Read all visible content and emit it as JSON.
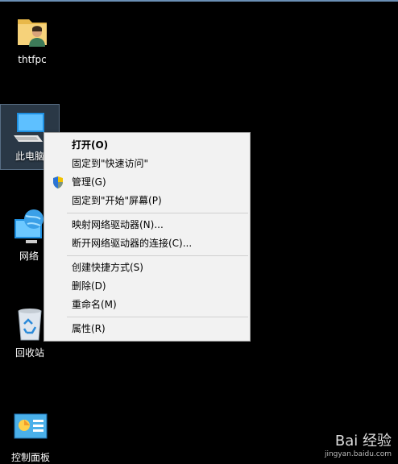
{
  "desktop": {
    "icons": [
      {
        "label": "thtfpc",
        "icon": "user-folder-icon"
      },
      {
        "label": "此电脑",
        "icon": "this-pc-icon"
      },
      {
        "label": "网络",
        "icon": "network-icon"
      },
      {
        "label": "回收站",
        "icon": "recycle-bin-icon"
      },
      {
        "label": "控制面板",
        "icon": "control-panel-icon"
      }
    ]
  },
  "context_menu": {
    "items": [
      {
        "label": "打开(O)",
        "bold": true
      },
      {
        "label": "固定到\"快速访问\""
      },
      {
        "label": "管理(G)",
        "icon": "uac-shield-icon"
      },
      {
        "label": "固定到\"开始\"屏幕(P)"
      },
      {
        "label": "映射网络驱动器(N)..."
      },
      {
        "label": "断开网络驱动器的连接(C)..."
      },
      {
        "label": "创建快捷方式(S)"
      },
      {
        "label": "删除(D)"
      },
      {
        "label": "重命名(M)"
      },
      {
        "label": "属性(R)"
      }
    ]
  },
  "watermark": {
    "brand": "Bai 经验",
    "url": "jingyan.baidu.com"
  }
}
